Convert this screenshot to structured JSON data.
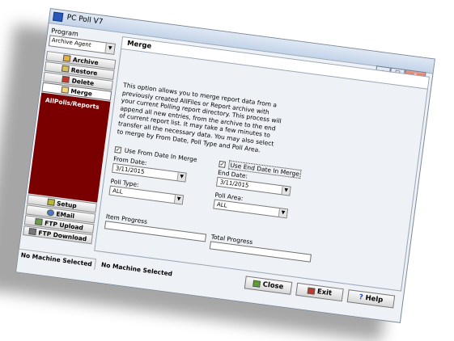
{
  "window": {
    "title": "PC Poll V7"
  },
  "program": {
    "label": "Program",
    "selected": "Archive Agent"
  },
  "nav": {
    "archive": "Archive",
    "restore": "Restore",
    "delete": "Delete",
    "merge": "Merge",
    "panel_title": "AllPolls/Reports",
    "setup": "Setup",
    "email": "EMail",
    "ftp_upload": "FTP Upload",
    "ftp_download": "FTP Download"
  },
  "content": {
    "header": "Merge",
    "description": "This option allows you to merge report data from a previously created AllFiles or Report archive with your current Polling report directory. This process will append all new entries, from the archive to the end of current report list. It may take a few minutes to transfer all the necessary data. You may also select to merge by From Date, Poll Type and Poll Area.",
    "use_from_date": {
      "label": "Use From Date In Merge",
      "checked": true
    },
    "use_end_date": {
      "label": "Use End Date In Merge",
      "checked": true
    },
    "from_date": {
      "label": "From Date:",
      "value": "3/11/2015"
    },
    "end_date": {
      "label": "End Date:",
      "value": "3/11/2015"
    },
    "poll_type": {
      "label": "Poll Type:",
      "value": "ALL"
    },
    "poll_area": {
      "label": "Poll Area:",
      "value": "ALL"
    },
    "item_progress": {
      "label": "Item Progress",
      "value": 0
    },
    "total_progress": {
      "label": "Total Progress",
      "value": 0
    }
  },
  "status": {
    "left": "No Machine Selected",
    "right": "No Machine Selected"
  },
  "buttons": {
    "close": "Close",
    "exit": "Exit",
    "help": "Help"
  },
  "window_buttons": {
    "minimize": "–",
    "maximize": "□",
    "close": "x"
  },
  "icons": {
    "check": "✓",
    "dropdown": "▼",
    "help_glyph": "?"
  },
  "colors": {
    "sidebar_panel": "#7a0000",
    "title_gradient": "#c3d3e8"
  }
}
